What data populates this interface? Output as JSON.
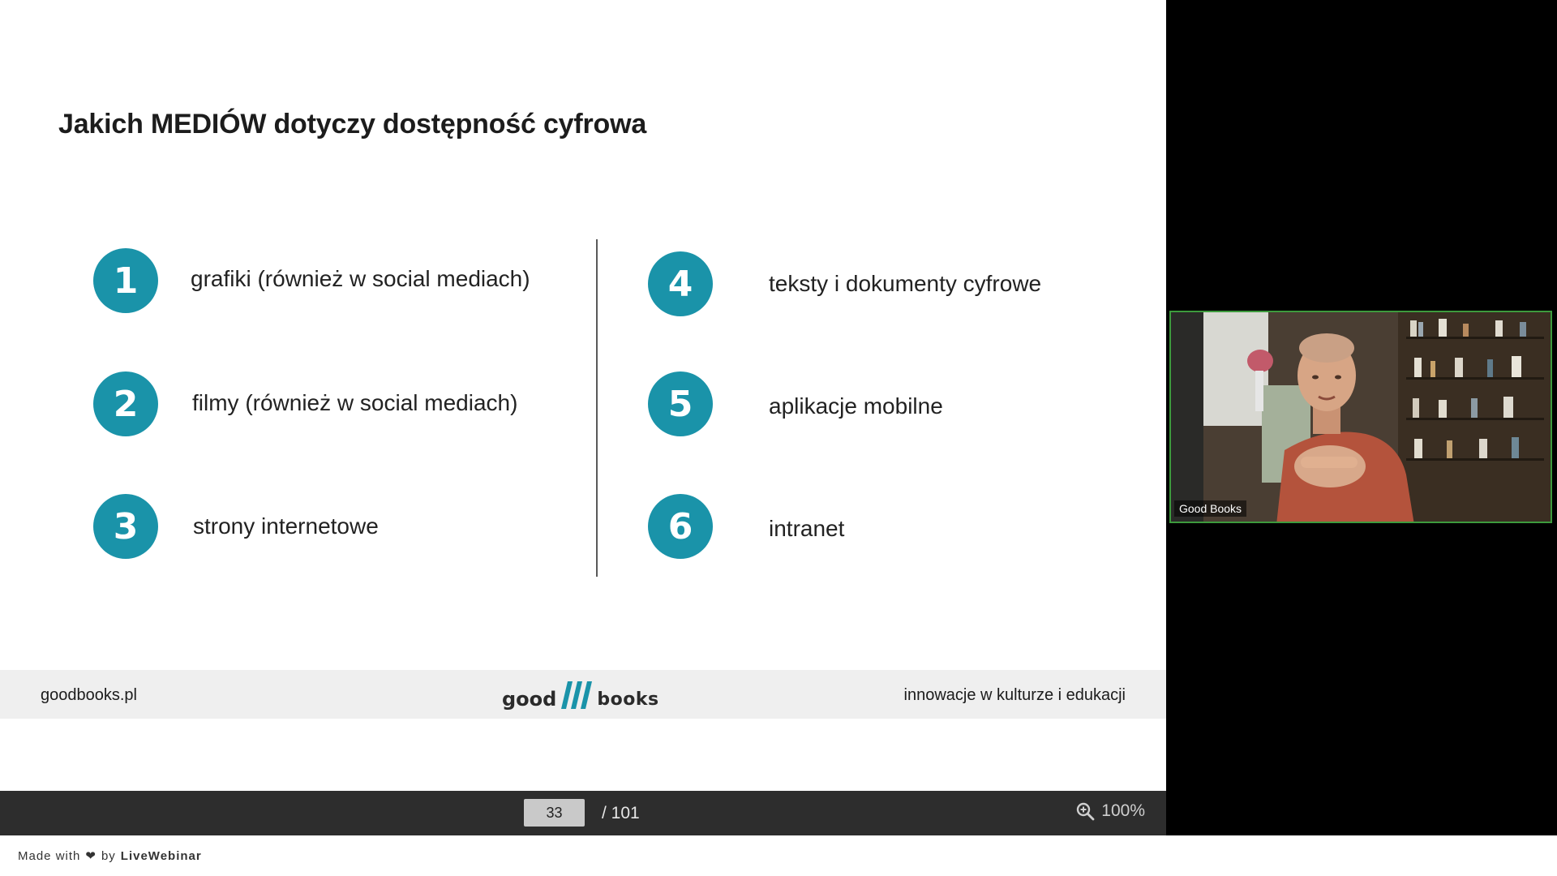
{
  "slide": {
    "title": "Jakich MEDIÓW dotyczy dostępność cyfrowa",
    "items": [
      {
        "number": "1",
        "label": "grafiki (również w social mediach)"
      },
      {
        "number": "2",
        "label": "filmy (również w social mediach)"
      },
      {
        "number": "3",
        "label": "strony internetowe"
      },
      {
        "number": "4",
        "label": "teksty i dokumenty cyfrowe"
      },
      {
        "number": "5",
        "label": "aplikacje mobilne"
      },
      {
        "number": "6",
        "label": "intranet"
      }
    ],
    "footer": {
      "left": "goodbooks.pl",
      "logo_left": "good",
      "logo_right": "books",
      "right": "innowacje w kulturze i edukacji"
    }
  },
  "pager": {
    "current_page": "33",
    "total": "/ 101",
    "zoom": "100%"
  },
  "branding": {
    "made_with": "Made with",
    "by": "by",
    "brand": "LiveWebinar"
  },
  "video": {
    "participant_name": "Good Books"
  },
  "colors": {
    "accent": "#1a93a9",
    "video_border": "#3d9a3d",
    "pager_bg": "#2d2d2d"
  }
}
